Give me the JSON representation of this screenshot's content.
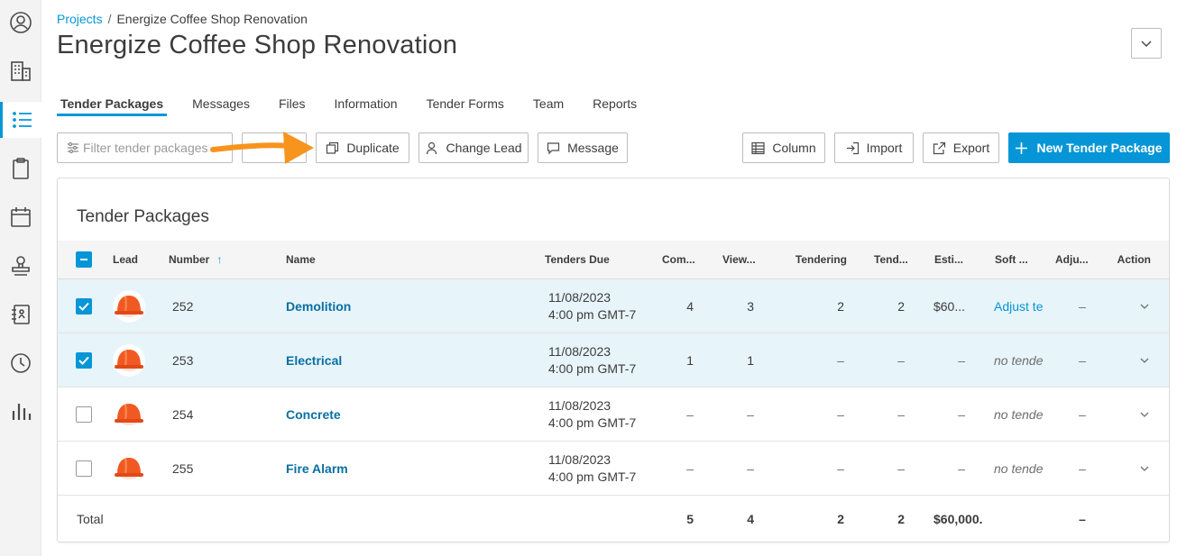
{
  "breadcrumb": {
    "root": "Projects",
    "separator": "/",
    "current": "Energize Coffee Shop Renovation"
  },
  "page_title": "Energize Coffee Shop Renovation",
  "tabs": [
    "Tender Packages",
    "Messages",
    "Files",
    "Information",
    "Tender Forms",
    "Team",
    "Reports"
  ],
  "active_tab": "Tender Packages",
  "toolbar": {
    "filter_placeholder": "Filter tender packages",
    "duplicate": "Duplicate",
    "change_lead": "Change Lead",
    "message": "Message",
    "column": "Column",
    "import": "Import",
    "export": "Export",
    "new_package": "New Tender Package"
  },
  "table": {
    "title": "Tender Packages",
    "headers": {
      "lead": "Lead",
      "number": "Number",
      "name": "Name",
      "due": "Tenders Due",
      "com": "Com...",
      "view": "View...",
      "tendering": "Tendering",
      "tend": "Tend...",
      "esti": "Esti...",
      "soft": "Soft ...",
      "adju": "Adju...",
      "action": "Action"
    },
    "rows": [
      {
        "selected": true,
        "number": "252",
        "name": "Demolition",
        "due_date": "11/08/2023",
        "due_time": "4:00 pm GMT-7",
        "com": "4",
        "view": "3",
        "tendering": "2",
        "tend": "2",
        "esti": "$60...",
        "soft": "Adjust te",
        "adju": "–"
      },
      {
        "selected": true,
        "number": "253",
        "name": "Electrical",
        "due_date": "11/08/2023",
        "due_time": "4:00 pm GMT-7",
        "com": "1",
        "view": "1",
        "tendering": "–",
        "tend": "–",
        "esti": "–",
        "soft": "no tende",
        "adju": "–"
      },
      {
        "selected": false,
        "number": "254",
        "name": "Concrete",
        "due_date": "11/08/2023",
        "due_time": "4:00 pm GMT-7",
        "com": "–",
        "view": "–",
        "tendering": "–",
        "tend": "–",
        "esti": "–",
        "soft": "no tende",
        "adju": "–"
      },
      {
        "selected": false,
        "number": "255",
        "name": "Fire Alarm",
        "due_date": "11/08/2023",
        "due_time": "4:00 pm GMT-7",
        "com": "–",
        "view": "–",
        "tendering": "–",
        "tend": "–",
        "esti": "–",
        "soft": "no tende",
        "adju": "–"
      }
    ],
    "total": {
      "label": "Total",
      "com": "5",
      "view": "4",
      "tendering": "2",
      "tend": "2",
      "esti": "$60,000.",
      "adju": "–"
    }
  },
  "colors": {
    "accent": "#0696d7",
    "link": "#0a6fa3",
    "selected_row": "#e7f4fa",
    "arrow": "#f7941d"
  },
  "rail_icons": [
    "user-circle-icon",
    "building-icon",
    "list-icon",
    "clipboard-icon",
    "calendar-icon",
    "stamp-icon",
    "address-book-icon",
    "clock-icon",
    "bar-chart-icon"
  ]
}
